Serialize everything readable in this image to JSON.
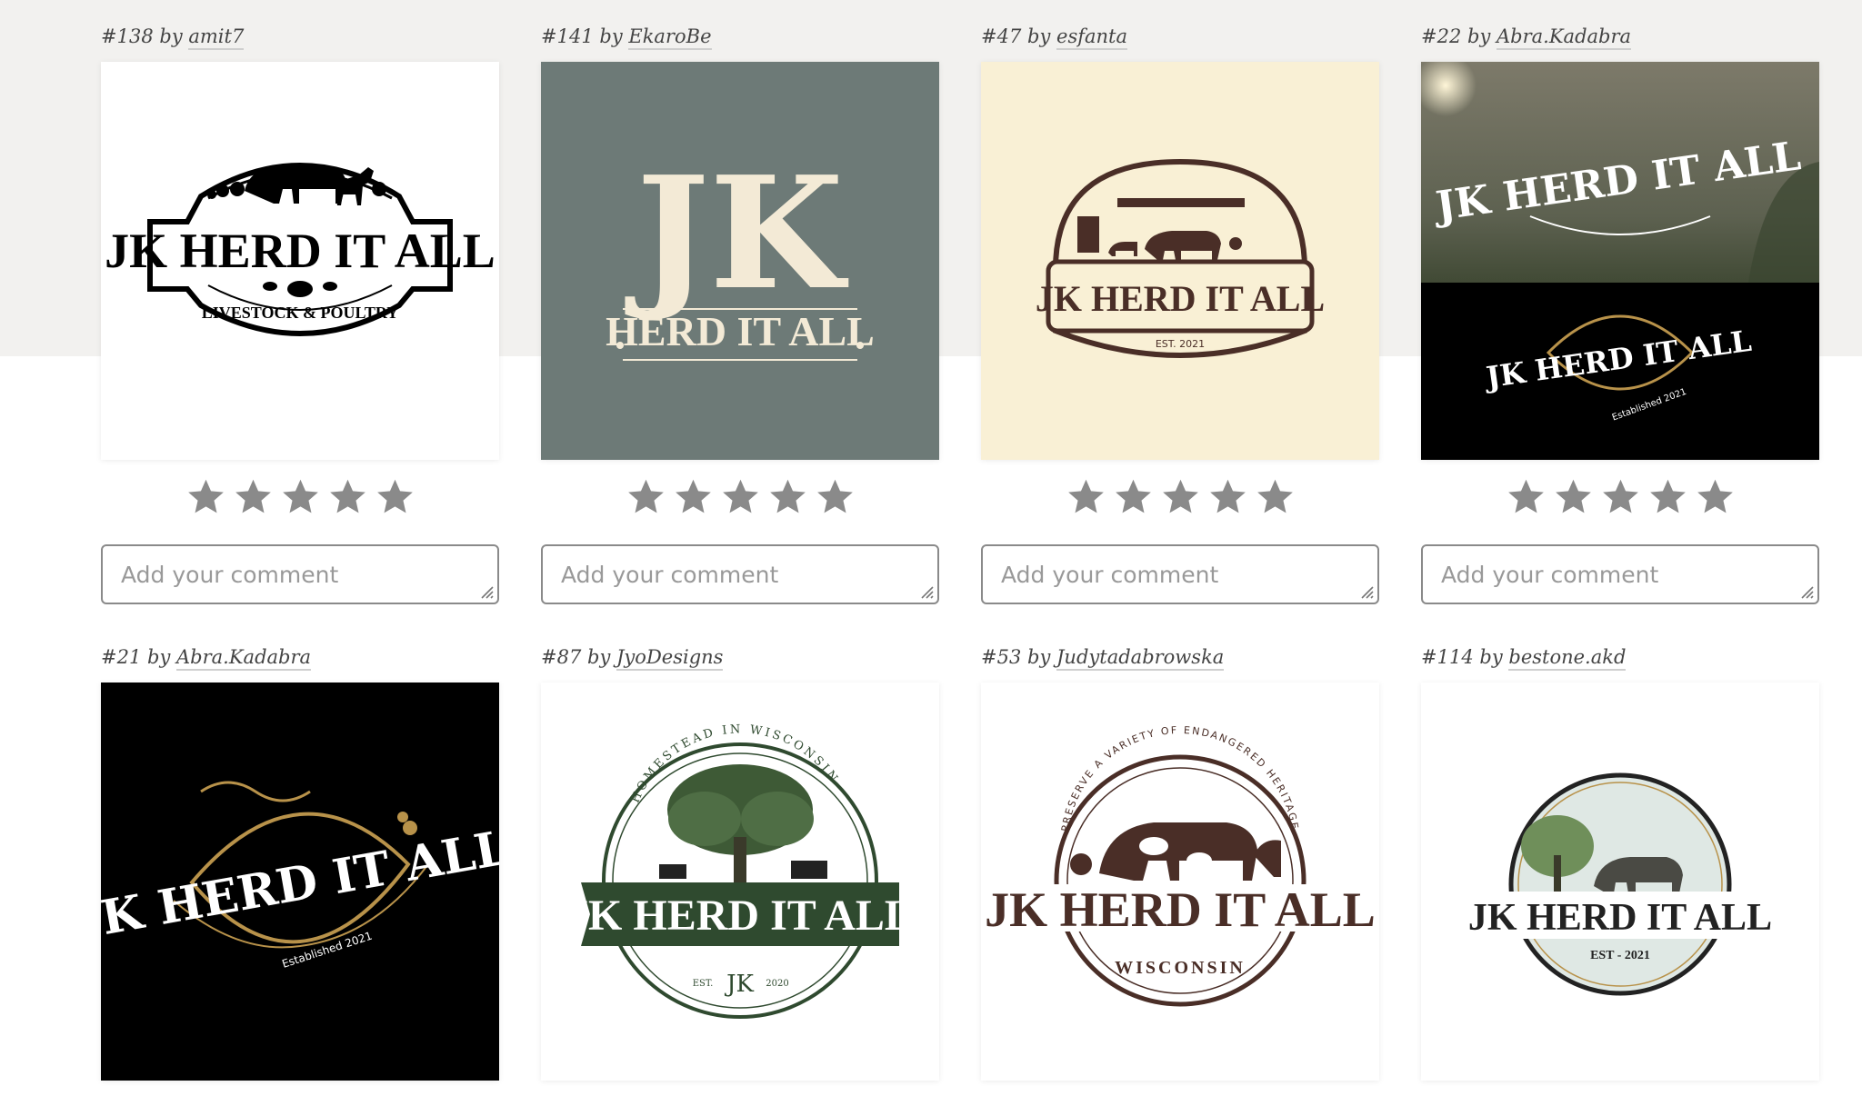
{
  "comment_placeholder": "Add your comment",
  "entries": [
    {
      "number": "#138",
      "by": "by",
      "designer": "amit7",
      "logo": {
        "line1": "JK HERD IT ALL",
        "line2": "LIVESTOCK & POULTRY"
      },
      "background": "#ffffff"
    },
    {
      "number": "#141",
      "by": "by",
      "designer": "EkaroBe",
      "logo": {
        "line1": "JK",
        "line2": "HERD IT ALL"
      },
      "background": "#6d7a77"
    },
    {
      "number": "#47",
      "by": "by",
      "designer": "esfanta",
      "logo": {
        "line1": "JK HERD IT ALL",
        "line2": "EST. 2021"
      },
      "background": "#f9f0d5"
    },
    {
      "number": "#22",
      "by": "by",
      "designer": "Abra.Kadabra",
      "logo": {
        "line1": "JK HERD IT ALL",
        "line2": "Established 2021"
      },
      "background": "#000000"
    },
    {
      "number": "#21",
      "by": "by",
      "designer": "Abra.Kadabra",
      "logo": {
        "line1": "JK HERD IT ALL",
        "line2": "Established 2021"
      },
      "background": "#000000"
    },
    {
      "number": "#87",
      "by": "by",
      "designer": "JyoDesigns",
      "logo": {
        "line1": "JK HERD IT ALL",
        "arc": "HOMESTEAD IN WISCONSIN",
        "est": "EST.",
        "monogram": "JK",
        "year": "2020"
      },
      "background": "#ffffff"
    },
    {
      "number": "#53",
      "by": "by",
      "designer": "Judytadabrowska",
      "logo": {
        "line1": "JK HERD IT ALL",
        "arc": "PRESERVE A VARIETY OF ENDANGERED HERITAGE",
        "line2": "WISCONSIN"
      },
      "background": "#ffffff"
    },
    {
      "number": "#114",
      "by": "by",
      "designer": "bestone.akd",
      "logo": {
        "line1": "JK HERD IT ALL",
        "line2": "EST - 2021"
      },
      "background": "#ffffff"
    }
  ],
  "colors": {
    "star": "#8a8a8a",
    "sage": "#6d7a77",
    "cream": "#f9f0d5",
    "brown": "#4a2e27",
    "forest": "#2f4a2f",
    "gold": "#b8924a"
  }
}
